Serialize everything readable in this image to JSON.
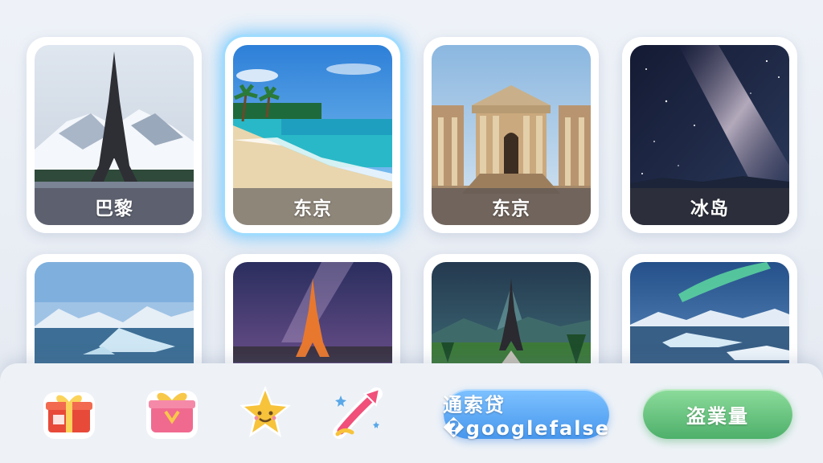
{
  "destinations": [
    {
      "label": "巴黎",
      "scene": "eiffel-snow-mountains"
    },
    {
      "label": "东京",
      "scene": "tropical-beach",
      "selected": true
    },
    {
      "label": "东京",
      "scene": "classical-temple-ruins"
    },
    {
      "label": "冰岛",
      "scene": "milky-way-night-sky"
    },
    {
      "label": "",
      "scene": "icebergs-lagoon"
    },
    {
      "label": "",
      "scene": "eiffel-tower-starry-night"
    },
    {
      "label": "",
      "scene": "eiffel-tower-forest-aurora"
    },
    {
      "label": "",
      "scene": "aurora-glacier"
    }
  ],
  "toolbar": {
    "stickers": [
      {
        "icon": "gift-box-icon"
      },
      {
        "icon": "pink-gift-icon"
      },
      {
        "icon": "smiling-star-icon"
      },
      {
        "icon": "shooting-arrow-icon"
      }
    ],
    "primary_button_label": "通索贷�googlefalse",
    "secondary_button_label": "盗業量"
  },
  "colors": {
    "selection_glow": "#5abeff",
    "primary_button": "#4797ee",
    "secondary_button": "#4db06a"
  }
}
